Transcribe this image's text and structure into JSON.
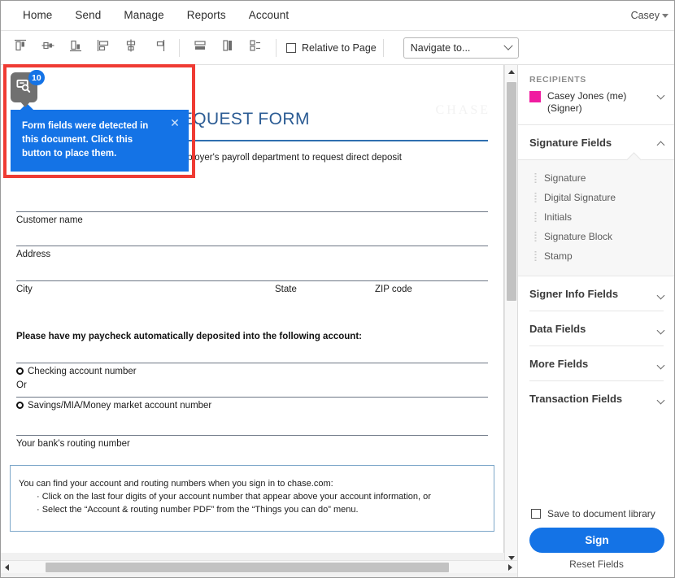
{
  "topnav": {
    "items": [
      {
        "label": "Home"
      },
      {
        "label": "Send"
      },
      {
        "label": "Manage"
      },
      {
        "label": "Reports"
      },
      {
        "label": "Account"
      }
    ],
    "user": "Casey",
    "user_caret_icon": "caret-down-icon"
  },
  "toolbar": {
    "buttons": [
      {
        "icon": "align-top-icon",
        "tip": "Align Top"
      },
      {
        "icon": "align-middle-horizontal-icon",
        "tip": "Align Middle"
      },
      {
        "icon": "align-bottom-icon",
        "tip": "Align Bottom"
      },
      {
        "icon": "align-left-icon",
        "tip": "Align Left"
      },
      {
        "icon": "align-center-icon",
        "tip": "Align Center"
      },
      {
        "icon": "align-right-icon",
        "tip": "Align Right"
      },
      {
        "icon": "same-width-icon",
        "tip": "Same Width"
      },
      {
        "icon": "same-height-icon",
        "tip": "Same Height"
      },
      {
        "icon": "same-size-icon",
        "tip": "Same Size"
      }
    ],
    "relative_to_page_label": "Relative to Page",
    "relative_to_page_checked": false,
    "navigate_value": "Navigate to...",
    "navigate_chevron_icon": "chevron-down-icon"
  },
  "callout": {
    "badge_count": "10",
    "button_icon": "detect-form-fields-icon",
    "message": "Form fields were detected in this document. Click this button to place them.",
    "close_icon": "close-icon",
    "highlight_color": "#ef3b33",
    "tooltip_color": "#1473e6"
  },
  "document": {
    "watermark": "CHASE",
    "title": "DIRECT DEPOSIT REQUEST FORM",
    "subtitle": "Complete this form and take it to your employer's payroll department to request direct deposit",
    "fields": [
      {
        "label": "Customer name"
      },
      {
        "label": "Address"
      }
    ],
    "city_row": {
      "city": "City",
      "state": "State",
      "zip": "ZIP code"
    },
    "account_heading": "Please have my paycheck automatically deposited into the following account:",
    "option_checking": "Checking account number",
    "or_text": "Or",
    "option_savings": "Savings/MIA/Money market account number",
    "routing_label": "Your bank's routing number",
    "infobox": {
      "intro": "You can find your account and routing numbers when you sign in to chase.com:",
      "bullets": [
        "· Click on the last four digits of your account number that appear above your account information, or",
        "· Select the “Account & routing number PDF” from the “Things you can do” menu."
      ]
    },
    "scroll": {
      "v_up_icon": "scroll-up-arrow-icon",
      "v_down_icon": "scroll-down-arrow-icon",
      "h_left_icon": "scroll-left-arrow-icon",
      "h_right_icon": "scroll-right-arrow-icon"
    }
  },
  "panel": {
    "recipients_label": "RECIPIENTS",
    "recipient_name": "Casey Jones (me) (Signer)",
    "recipient_color": "#f01ca0",
    "recipient_chevron_icon": "chevron-down-icon",
    "sections": [
      {
        "title": "Signature Fields",
        "expanded": true,
        "chevron_icon": "chevron-up-icon"
      },
      {
        "title": "Signer Info Fields",
        "expanded": false,
        "chevron_icon": "chevron-down-icon"
      },
      {
        "title": "Data Fields",
        "expanded": false,
        "chevron_icon": "chevron-down-icon"
      },
      {
        "title": "More Fields",
        "expanded": false,
        "chevron_icon": "chevron-down-icon"
      },
      {
        "title": "Transaction Fields",
        "expanded": false,
        "chevron_icon": "chevron-down-icon"
      }
    ],
    "signature_fields": [
      {
        "label": "Signature"
      },
      {
        "label": "Digital Signature"
      },
      {
        "label": "Initials"
      },
      {
        "label": "Signature Block"
      },
      {
        "label": "Stamp"
      }
    ],
    "save_to_library_label": "Save to document library",
    "save_to_library_checked": false,
    "sign_button_label": "Sign",
    "sign_button_color": "#1473e6",
    "reset_fields_label": "Reset Fields"
  }
}
